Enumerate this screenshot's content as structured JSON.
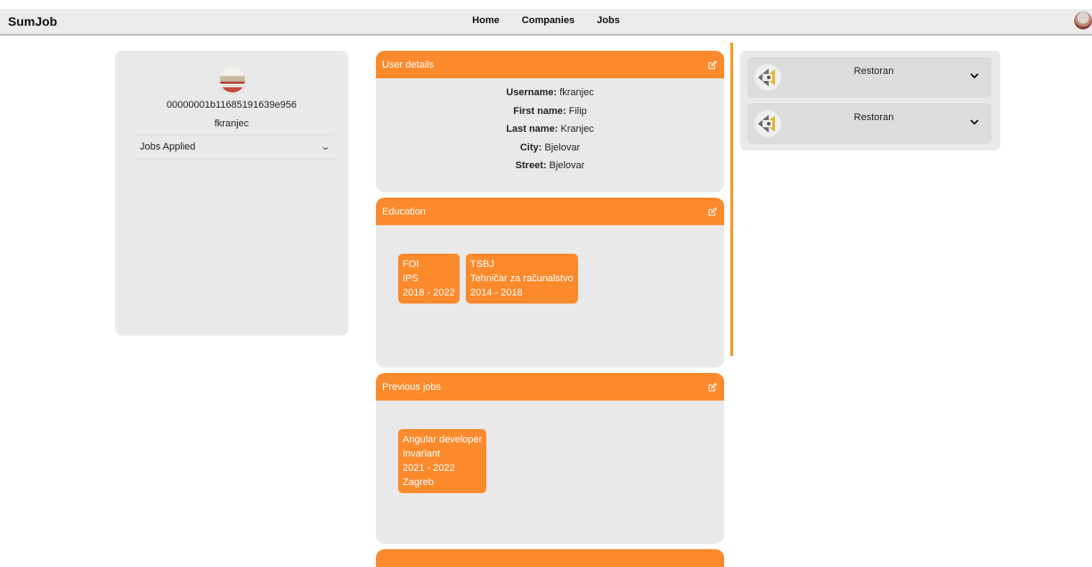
{
  "app": {
    "brand": "SumJob"
  },
  "nav": {
    "home": "Home",
    "companies": "Companies",
    "jobs": "Jobs"
  },
  "profile": {
    "id": "00000001b11685191639e956",
    "username": "fkranjec",
    "jobs_applied_label": "Jobs Applied"
  },
  "user_details": {
    "title": "User details",
    "rows": [
      {
        "label": "Username:",
        "value": "fkranjec"
      },
      {
        "label": "First name:",
        "value": "Filip"
      },
      {
        "label": "Last name:",
        "value": "Kranjec"
      },
      {
        "label": "City:",
        "value": "Bjelovar"
      },
      {
        "label": "Street:",
        "value": "Bjelovar"
      }
    ]
  },
  "education": {
    "title": "Education",
    "items": [
      {
        "school": "FOI",
        "program": "IPS",
        "years": "2018 - 2022"
      },
      {
        "school": "TSBJ",
        "program": "Tehničar za računalstvo",
        "years": "2014 - 2018"
      }
    ]
  },
  "previous_jobs": {
    "title": "Previous jobs",
    "items": [
      {
        "position": "Angular developer",
        "company": "Invariant",
        "years": "2021 - 2022",
        "city": "Zagreb"
      }
    ]
  },
  "companies": [
    {
      "name": "Restoran"
    },
    {
      "name": "Restoran"
    }
  ],
  "colors": {
    "accent": "#fb8a2c",
    "panel": "#e9e9e9",
    "divider": "#f9961e"
  }
}
